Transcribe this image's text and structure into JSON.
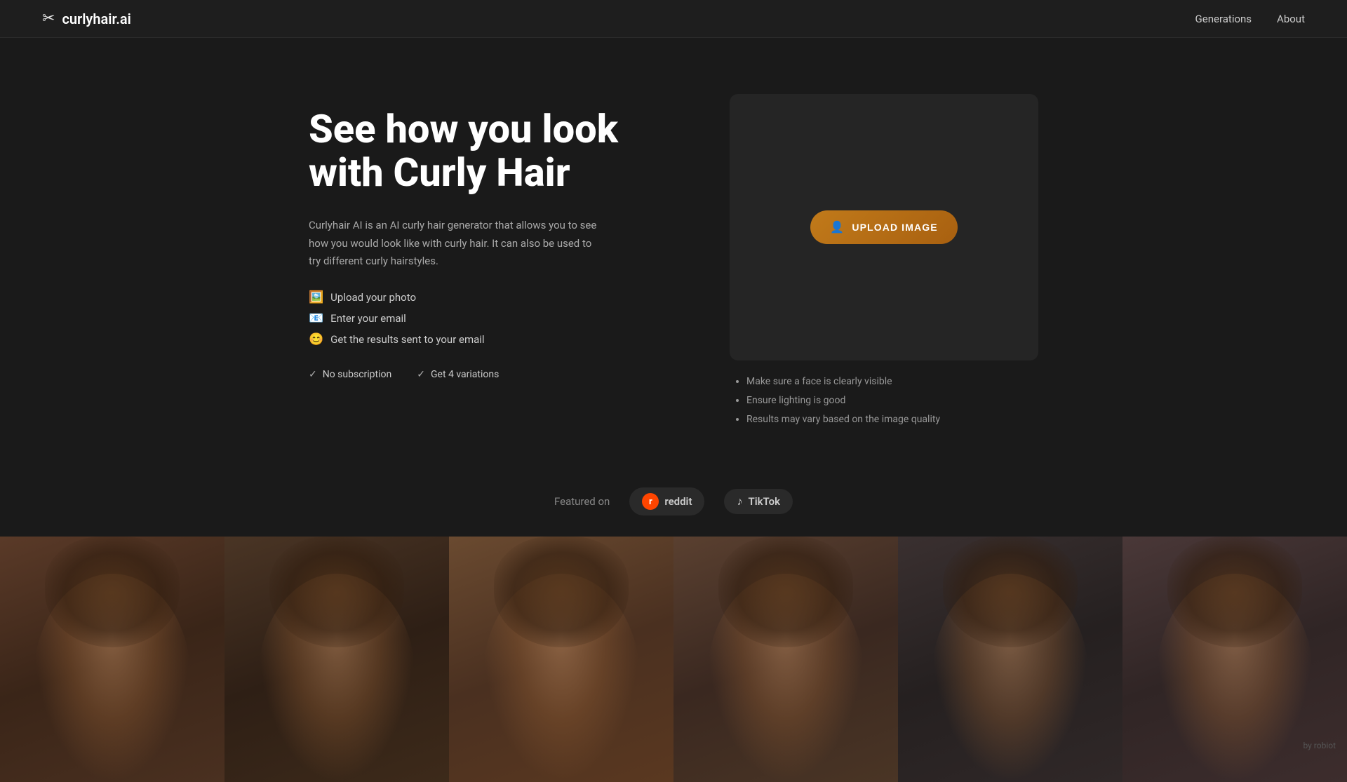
{
  "site": {
    "logo_icon": "✂",
    "logo_text": "curlyhair.ai"
  },
  "nav": {
    "generations_label": "Generations",
    "about_label": "About"
  },
  "hero": {
    "title_line1": "See how you look",
    "title_line2": "with Curly Hair",
    "description": "Curlyhair AI is an AI curly hair generator that allows you to see how you would look like with curly hair. It can also be used to try different curly hairstyles.",
    "steps": [
      {
        "emoji": "🖼",
        "text": "Upload your photo"
      },
      {
        "emoji": "📧",
        "text": "Enter your email"
      },
      {
        "emoji": "😊",
        "text": "Get the results sent to your email"
      }
    ],
    "badges": [
      {
        "label": "No subscription"
      },
      {
        "label": "Get 4 variations"
      }
    ],
    "upload_button_label": "UPLOAD IMAGE"
  },
  "upload_tips": {
    "items": [
      "Make sure a face is clearly visible",
      "Ensure lighting is good",
      "Results may vary based on the image quality"
    ]
  },
  "featured": {
    "label": "Featured on",
    "platforms": [
      {
        "name": "reddit",
        "display": "reddit"
      },
      {
        "name": "tiktok",
        "display": "TikTok"
      }
    ]
  },
  "gallery": {
    "items": [
      1,
      2,
      3,
      4,
      5,
      6
    ]
  },
  "watermark": {
    "text": "by robiot"
  }
}
